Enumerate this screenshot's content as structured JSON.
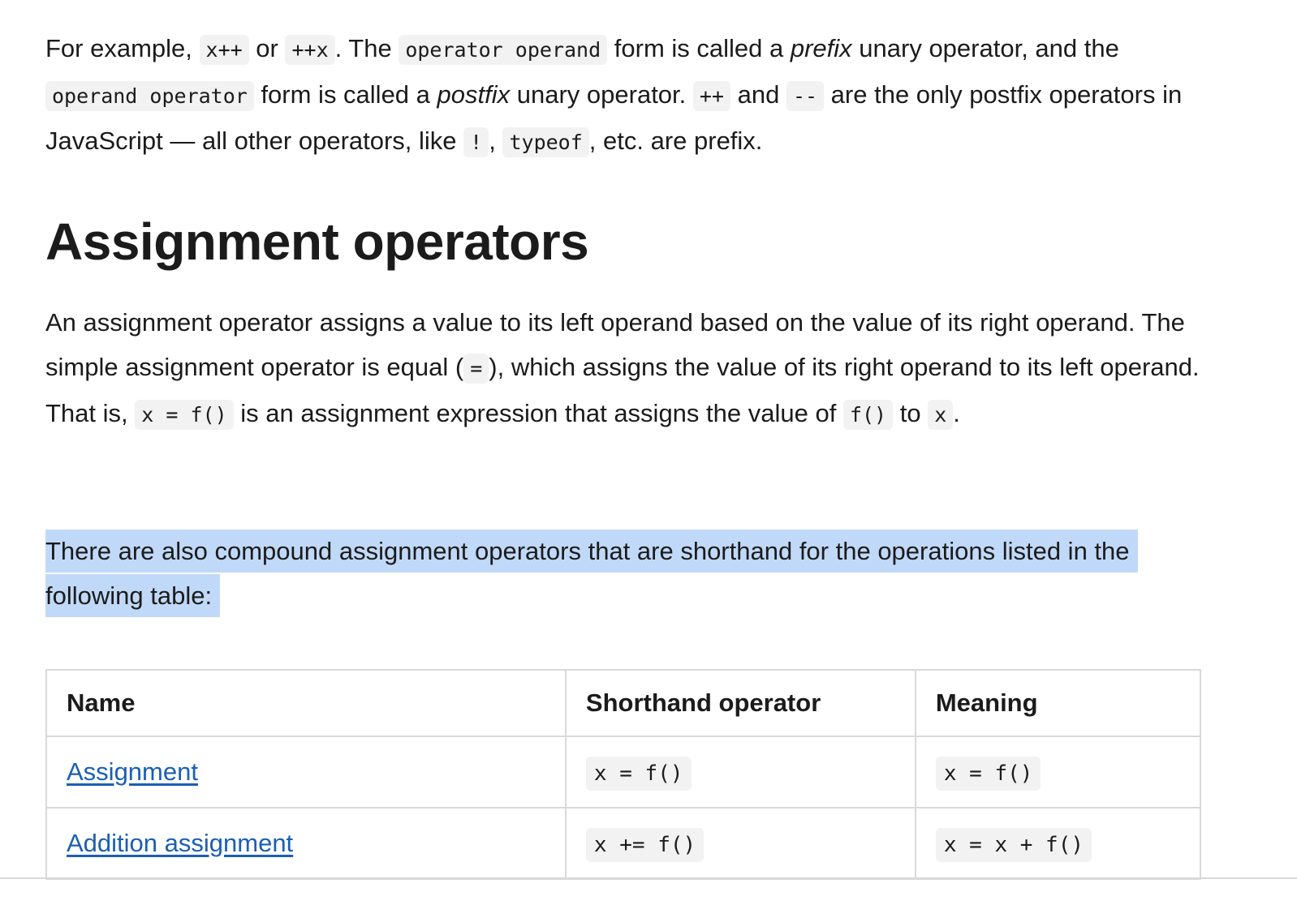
{
  "intro": {
    "t1": "For example, ",
    "c1": "x++",
    "t2": " or ",
    "c2": "++x",
    "t3": ". The ",
    "c3": "operator operand",
    "t4": " form is called a ",
    "e1": "prefix",
    "t5": " unary operator, and the ",
    "c4": "operand operator",
    "t6": " form is called a ",
    "e2": "postfix",
    "t7": " unary operator. ",
    "c5": "++",
    "t8": " and ",
    "c6": "--",
    "t9": " are the only postfix operators in JavaScript — all other operators, like ",
    "c7": "!",
    "t10": ", ",
    "c8": "typeof",
    "t11": ", etc. are prefix."
  },
  "heading": "Assignment operators",
  "assign": {
    "t1": "An assignment operator assigns a value to its left operand based on the value of its right operand. The simple assignment operator is equal (",
    "c1": "=",
    "t2": "), which assigns the value of its right operand to its left operand. That is, ",
    "c2": "x = f()",
    "t3": " is an assignment expression that assigns the value of ",
    "c3": "f()",
    "t4": " to ",
    "c4": "x",
    "t5": "."
  },
  "compound_text": "There are also compound assignment operators that are shorthand for the operations listed in the following table:",
  "table": {
    "headers": [
      "Name",
      "Shorthand operator",
      "Meaning"
    ],
    "rows": [
      {
        "name": "Assignment",
        "shorthand": "x = f()",
        "meaning": "x = f()"
      },
      {
        "name": "Addition assignment",
        "shorthand": "x += f()",
        "meaning": "x = x + f()"
      }
    ]
  }
}
